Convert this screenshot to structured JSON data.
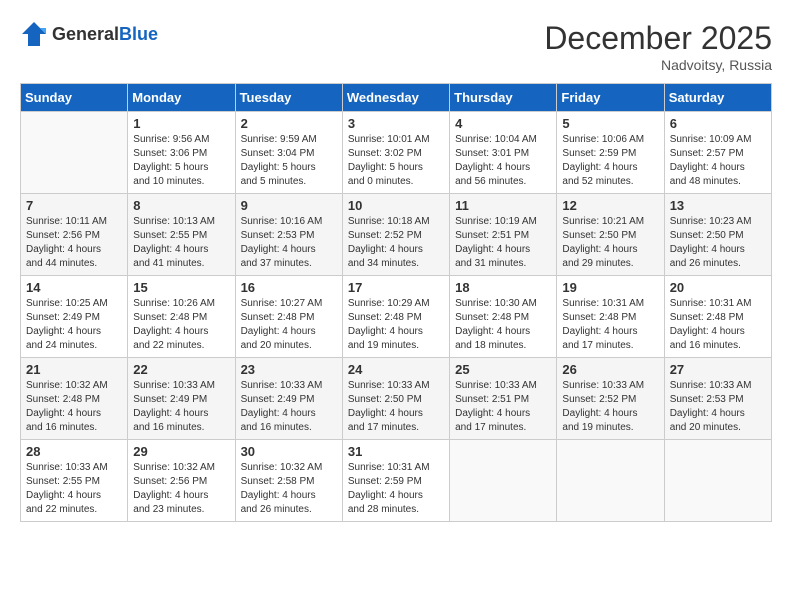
{
  "header": {
    "logo_general": "General",
    "logo_blue": "Blue",
    "month_title": "December 2025",
    "location": "Nadvoitsy, Russia"
  },
  "days_of_week": [
    "Sunday",
    "Monday",
    "Tuesday",
    "Wednesday",
    "Thursday",
    "Friday",
    "Saturday"
  ],
  "weeks": [
    [
      {
        "day": "",
        "info": ""
      },
      {
        "day": "1",
        "info": "Sunrise: 9:56 AM\nSunset: 3:06 PM\nDaylight: 5 hours\nand 10 minutes."
      },
      {
        "day": "2",
        "info": "Sunrise: 9:59 AM\nSunset: 3:04 PM\nDaylight: 5 hours\nand 5 minutes."
      },
      {
        "day": "3",
        "info": "Sunrise: 10:01 AM\nSunset: 3:02 PM\nDaylight: 5 hours\nand 0 minutes."
      },
      {
        "day": "4",
        "info": "Sunrise: 10:04 AM\nSunset: 3:01 PM\nDaylight: 4 hours\nand 56 minutes."
      },
      {
        "day": "5",
        "info": "Sunrise: 10:06 AM\nSunset: 2:59 PM\nDaylight: 4 hours\nand 52 minutes."
      },
      {
        "day": "6",
        "info": "Sunrise: 10:09 AM\nSunset: 2:57 PM\nDaylight: 4 hours\nand 48 minutes."
      }
    ],
    [
      {
        "day": "7",
        "info": "Sunrise: 10:11 AM\nSunset: 2:56 PM\nDaylight: 4 hours\nand 44 minutes."
      },
      {
        "day": "8",
        "info": "Sunrise: 10:13 AM\nSunset: 2:55 PM\nDaylight: 4 hours\nand 41 minutes."
      },
      {
        "day": "9",
        "info": "Sunrise: 10:16 AM\nSunset: 2:53 PM\nDaylight: 4 hours\nand 37 minutes."
      },
      {
        "day": "10",
        "info": "Sunrise: 10:18 AM\nSunset: 2:52 PM\nDaylight: 4 hours\nand 34 minutes."
      },
      {
        "day": "11",
        "info": "Sunrise: 10:19 AM\nSunset: 2:51 PM\nDaylight: 4 hours\nand 31 minutes."
      },
      {
        "day": "12",
        "info": "Sunrise: 10:21 AM\nSunset: 2:50 PM\nDaylight: 4 hours\nand 29 minutes."
      },
      {
        "day": "13",
        "info": "Sunrise: 10:23 AM\nSunset: 2:50 PM\nDaylight: 4 hours\nand 26 minutes."
      }
    ],
    [
      {
        "day": "14",
        "info": "Sunrise: 10:25 AM\nSunset: 2:49 PM\nDaylight: 4 hours\nand 24 minutes."
      },
      {
        "day": "15",
        "info": "Sunrise: 10:26 AM\nSunset: 2:48 PM\nDaylight: 4 hours\nand 22 minutes."
      },
      {
        "day": "16",
        "info": "Sunrise: 10:27 AM\nSunset: 2:48 PM\nDaylight: 4 hours\nand 20 minutes."
      },
      {
        "day": "17",
        "info": "Sunrise: 10:29 AM\nSunset: 2:48 PM\nDaylight: 4 hours\nand 19 minutes."
      },
      {
        "day": "18",
        "info": "Sunrise: 10:30 AM\nSunset: 2:48 PM\nDaylight: 4 hours\nand 18 minutes."
      },
      {
        "day": "19",
        "info": "Sunrise: 10:31 AM\nSunset: 2:48 PM\nDaylight: 4 hours\nand 17 minutes."
      },
      {
        "day": "20",
        "info": "Sunrise: 10:31 AM\nSunset: 2:48 PM\nDaylight: 4 hours\nand 16 minutes."
      }
    ],
    [
      {
        "day": "21",
        "info": "Sunrise: 10:32 AM\nSunset: 2:48 PM\nDaylight: 4 hours\nand 16 minutes."
      },
      {
        "day": "22",
        "info": "Sunrise: 10:33 AM\nSunset: 2:49 PM\nDaylight: 4 hours\nand 16 minutes."
      },
      {
        "day": "23",
        "info": "Sunrise: 10:33 AM\nSunset: 2:49 PM\nDaylight: 4 hours\nand 16 minutes."
      },
      {
        "day": "24",
        "info": "Sunrise: 10:33 AM\nSunset: 2:50 PM\nDaylight: 4 hours\nand 17 minutes."
      },
      {
        "day": "25",
        "info": "Sunrise: 10:33 AM\nSunset: 2:51 PM\nDaylight: 4 hours\nand 17 minutes."
      },
      {
        "day": "26",
        "info": "Sunrise: 10:33 AM\nSunset: 2:52 PM\nDaylight: 4 hours\nand 19 minutes."
      },
      {
        "day": "27",
        "info": "Sunrise: 10:33 AM\nSunset: 2:53 PM\nDaylight: 4 hours\nand 20 minutes."
      }
    ],
    [
      {
        "day": "28",
        "info": "Sunrise: 10:33 AM\nSunset: 2:55 PM\nDaylight: 4 hours\nand 22 minutes."
      },
      {
        "day": "29",
        "info": "Sunrise: 10:32 AM\nSunset: 2:56 PM\nDaylight: 4 hours\nand 23 minutes."
      },
      {
        "day": "30",
        "info": "Sunrise: 10:32 AM\nSunset: 2:58 PM\nDaylight: 4 hours\nand 26 minutes."
      },
      {
        "day": "31",
        "info": "Sunrise: 10:31 AM\nSunset: 2:59 PM\nDaylight: 4 hours\nand 28 minutes."
      },
      {
        "day": "",
        "info": ""
      },
      {
        "day": "",
        "info": ""
      },
      {
        "day": "",
        "info": ""
      }
    ]
  ]
}
